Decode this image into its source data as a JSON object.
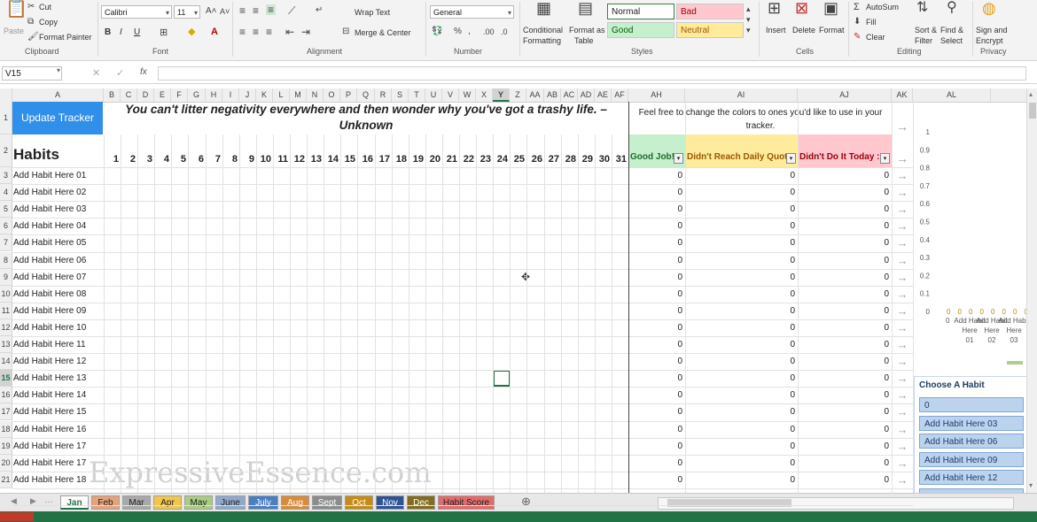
{
  "ribbon": {
    "clipboard": {
      "label": "Clipboard",
      "paste": "Paste",
      "cut": "Cut",
      "copy": "Copy",
      "format_painter": "Format Painter"
    },
    "font": {
      "label": "Font",
      "name": "Calibri",
      "size": "11",
      "bold": "B",
      "italic": "I",
      "underline": "U"
    },
    "alignment": {
      "label": "Alignment",
      "wrap_text": "Wrap Text",
      "merge_center": "Merge & Center"
    },
    "number": {
      "label": "Number",
      "format": "General"
    },
    "styles": {
      "label": "Styles",
      "conditional": "Conditional",
      "conditional2": "Formatting",
      "format_as": "Format as",
      "format_as2": "Table",
      "normal": "Normal",
      "bad": "Bad",
      "good": "Good",
      "neutral": "Neutral"
    },
    "cells": {
      "label": "Cells",
      "insert": "Insert",
      "delete": "Delete",
      "format": "Format"
    },
    "editing": {
      "label": "Editing",
      "autosum": "AutoSum",
      "fill": "Fill",
      "clear": "Clear",
      "sort": "Sort &",
      "sort2": "Filter",
      "find": "Find &",
      "find2": "Select"
    },
    "privacy": {
      "label": "Privacy",
      "sign": "Sign and",
      "sign2": "Encrypt"
    }
  },
  "formula_bar": {
    "name_box": "V15",
    "fx": "fx",
    "content": ""
  },
  "columns": [
    "A",
    "B",
    "C",
    "D",
    "E",
    "F",
    "G",
    "H",
    "I",
    "J",
    "K",
    "L",
    "M",
    "N",
    "O",
    "P",
    "Q",
    "R",
    "S",
    "T",
    "U",
    "V",
    "W",
    "X",
    "Y",
    "Z",
    "AA",
    "AB",
    "AC",
    "AD",
    "AE",
    "AF",
    "AH",
    "AI",
    "AJ",
    "AK",
    "AL"
  ],
  "sheet": {
    "update_button": "Update Tracker",
    "quote": "You can't litter negativity everywhere and then wonder why you've got a trashy life. – Unknown",
    "color_note": "Feel free to change the colors to ones you'd like to use in your tracker.",
    "habits_header": "Habits",
    "days": [
      "1",
      "2",
      "3",
      "4",
      "5",
      "6",
      "7",
      "8",
      "9",
      "10",
      "11",
      "12",
      "13",
      "14",
      "15",
      "16",
      "17",
      "18",
      "19",
      "20",
      "21",
      "22",
      "23",
      "24",
      "25",
      "26",
      "27",
      "28",
      "29",
      "30",
      "31"
    ],
    "summary_headers": [
      "Good Job!",
      "Didn't Reach Daily Quota",
      "Didn't Do It Today :("
    ],
    "row_numbers": [
      "1",
      "2",
      "3",
      "4",
      "5",
      "6",
      "7",
      "8",
      "9",
      "10",
      "11",
      "12",
      "13",
      "14",
      "15",
      "16",
      "17",
      "18",
      "19",
      "20",
      "21"
    ],
    "habits": [
      "Add Habit Here 01",
      "Add Habit Here 02",
      "Add Habit Here 03",
      "Add Habit Here 04",
      "Add Habit Here 05",
      "Add Habit Here 06",
      "Add Habit Here 07",
      "Add Habit Here 08",
      "Add Habit Here 09",
      "Add Habit Here 10",
      "Add Habit Here 11",
      "Add Habit Here 12",
      "Add Habit Here 13",
      "Add Habit Here 14",
      "Add Habit Here 15",
      "Add Habit Here 16",
      "Add Habit Here 17",
      "Add Habit Here 17",
      "Add Habit Here 18"
    ],
    "zero": "0"
  },
  "chart_data": {
    "type": "bar",
    "y_ticks": [
      "1",
      "0.9",
      "0.8",
      "0.7",
      "0.6",
      "0.5",
      "0.4",
      "0.3",
      "0.2",
      "0.1",
      "0"
    ],
    "ylim": [
      0,
      1
    ],
    "categories": [
      "Add Habit Here 01",
      "Add Habit Here 02",
      "Add Habit Here 03"
    ],
    "values": [
      0,
      0,
      0
    ],
    "first_label": "0"
  },
  "slicer": {
    "title": "Choose A Habit",
    "items": [
      "0",
      "Add Habit Here 03",
      "Add Habit Here 06",
      "Add Habit Here 09",
      "Add Habit Here 12"
    ]
  },
  "tabs": [
    {
      "label": "Jan",
      "color": "#ffffff",
      "active": true
    },
    {
      "label": "Feb",
      "color": "#e8a27a"
    },
    {
      "label": "Mar",
      "color": "#a9a9a9"
    },
    {
      "label": "Apr",
      "color": "#f2c64d"
    },
    {
      "label": "May",
      "color": "#a9cc83"
    },
    {
      "label": "June",
      "color": "#8ea9cc"
    },
    {
      "label": "July",
      "color": "#4a7ec2"
    },
    {
      "label": "Aug",
      "color": "#d98a3c"
    },
    {
      "label": "Sept",
      "color": "#8c8c8c"
    },
    {
      "label": "Oct",
      "color": "#c58b16"
    },
    {
      "label": "Nov",
      "color": "#2f5496"
    },
    {
      "label": "Dec",
      "color": "#836c1e"
    },
    {
      "label": "Habit Score",
      "color": "#e26b6b"
    }
  ],
  "watermark": "ExpressiveEssence.com",
  "colors": {
    "green": "#c6efce",
    "yellow": "#ffeb9c",
    "red": "#ffc7ce",
    "blue_btn": "#2f8fe9"
  }
}
